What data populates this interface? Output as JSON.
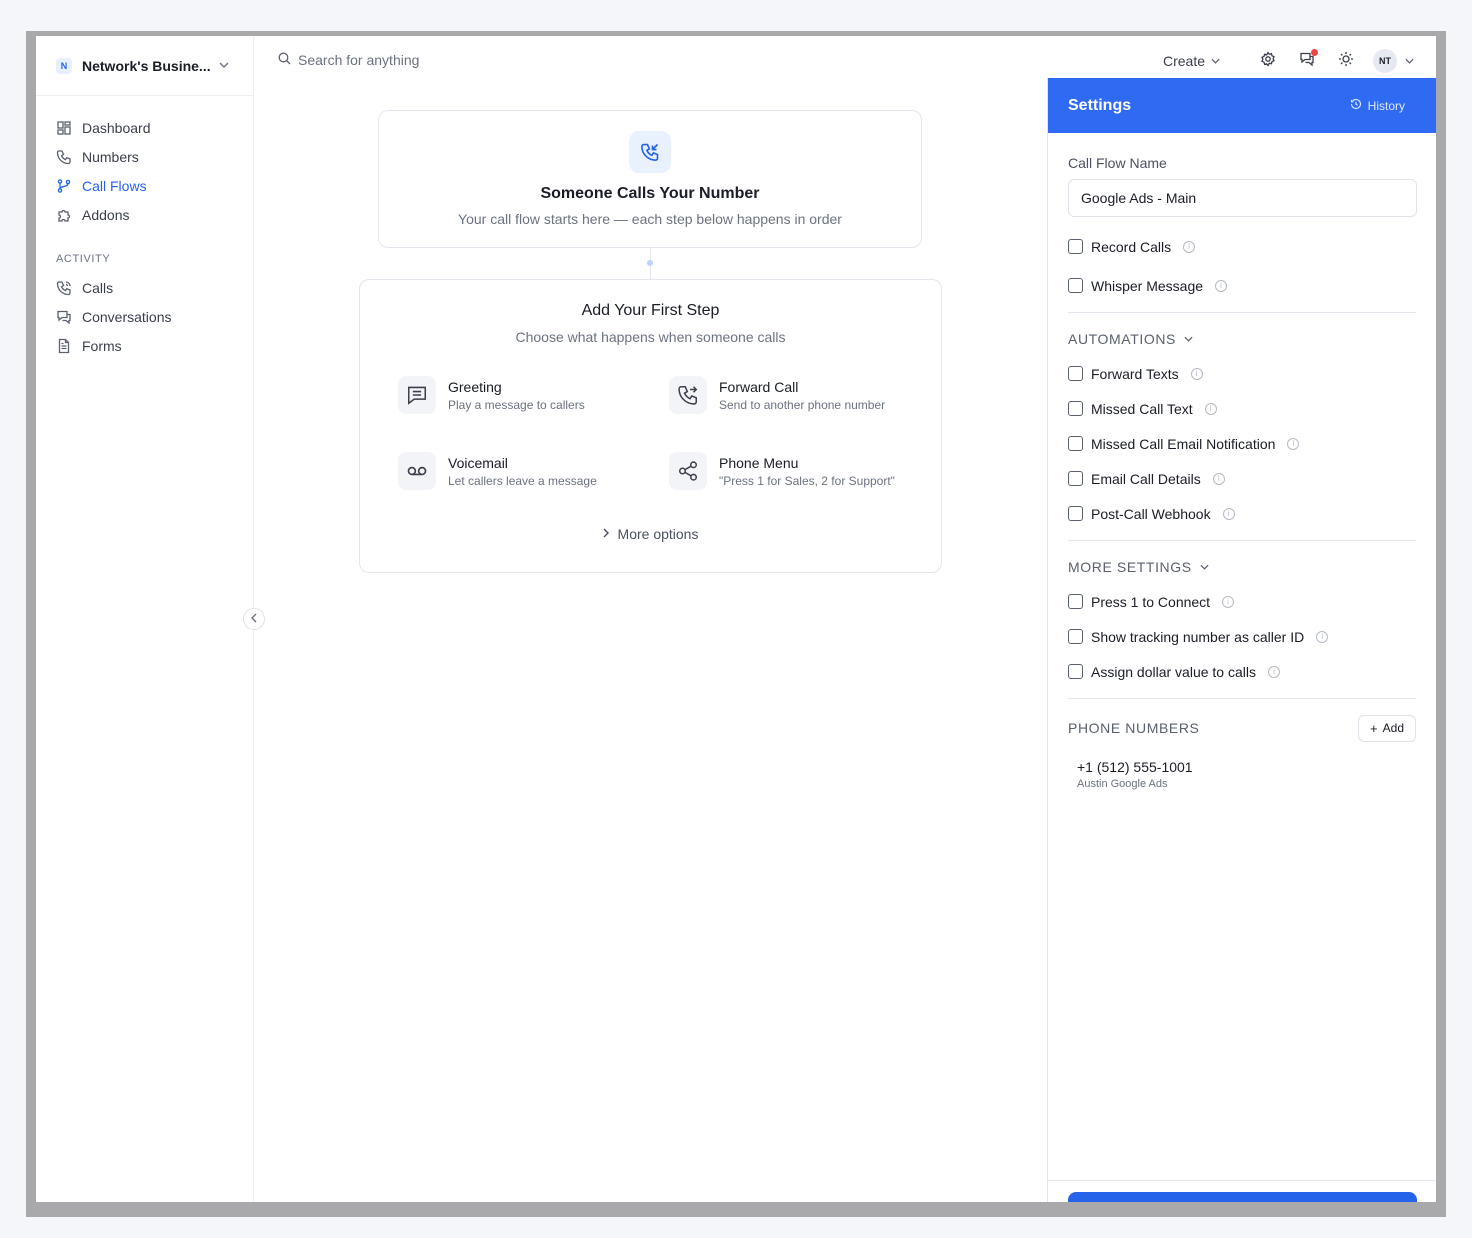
{
  "workspace": {
    "badge": "N",
    "name": "Network's Busine..."
  },
  "sidebar": {
    "items": [
      {
        "label": "Dashboard",
        "icon": "dashboard-icon",
        "active": false
      },
      {
        "label": "Numbers",
        "icon": "phone-icon",
        "active": false
      },
      {
        "label": "Call Flows",
        "icon": "flow-icon",
        "active": true
      },
      {
        "label": "Addons",
        "icon": "puzzle-icon",
        "active": false
      }
    ],
    "activity_label": "ACTIVITY",
    "activity": [
      {
        "label": "Calls",
        "icon": "phone-calls-icon"
      },
      {
        "label": "Conversations",
        "icon": "chat-icon"
      },
      {
        "label": "Forms",
        "icon": "document-icon"
      }
    ]
  },
  "topbar": {
    "search_placeholder": "Search for anything",
    "create_label": "Create",
    "avatar_initials": "NT"
  },
  "canvas": {
    "start": {
      "title": "Someone Calls Your Number",
      "subtitle": "Your call flow starts here — each step below happens in order"
    },
    "first_step": {
      "title": "Add Your First Step",
      "subtitle": "Choose what happens when someone calls",
      "options": [
        {
          "title": "Greeting",
          "desc": "Play a message to callers",
          "icon": "message-icon"
        },
        {
          "title": "Forward Call",
          "desc": "Send to another phone number",
          "icon": "forward-call-icon"
        },
        {
          "title": "Voicemail",
          "desc": "Let callers leave a message",
          "icon": "voicemail-icon"
        },
        {
          "title": "Phone Menu",
          "desc": "\"Press 1 for Sales, 2 for Support\"",
          "icon": "share-icon"
        }
      ],
      "more_label": "More options"
    }
  },
  "settings": {
    "title": "Settings",
    "history_label": "History",
    "flow_name_label": "Call Flow Name",
    "flow_name_value": "Google Ads - Main",
    "basic": [
      {
        "label": "Record Calls",
        "checked": false
      },
      {
        "label": "Whisper Message",
        "checked": false
      }
    ],
    "automations_label": "AUTOMATIONS",
    "automations": [
      {
        "label": "Forward Texts",
        "checked": false
      },
      {
        "label": "Missed Call Text",
        "checked": false
      },
      {
        "label": "Missed Call Email Notification",
        "checked": false
      },
      {
        "label": "Email Call Details",
        "checked": false
      },
      {
        "label": "Post-Call Webhook",
        "checked": false
      }
    ],
    "more_settings_label": "MORE SETTINGS",
    "more_settings": [
      {
        "label": "Press 1 to Connect",
        "checked": false
      },
      {
        "label": "Show tracking number as caller ID",
        "checked": false
      },
      {
        "label": "Assign dollar value to calls",
        "checked": false
      }
    ],
    "phone_numbers_label": "PHONE NUMBERS",
    "add_label": "Add",
    "phone_numbers": [
      {
        "number": "+1 (512) 555-1001",
        "name": "Austin Google Ads"
      }
    ]
  },
  "colors": {
    "accent": "#2f6bf2",
    "notification": "#ef4444"
  }
}
